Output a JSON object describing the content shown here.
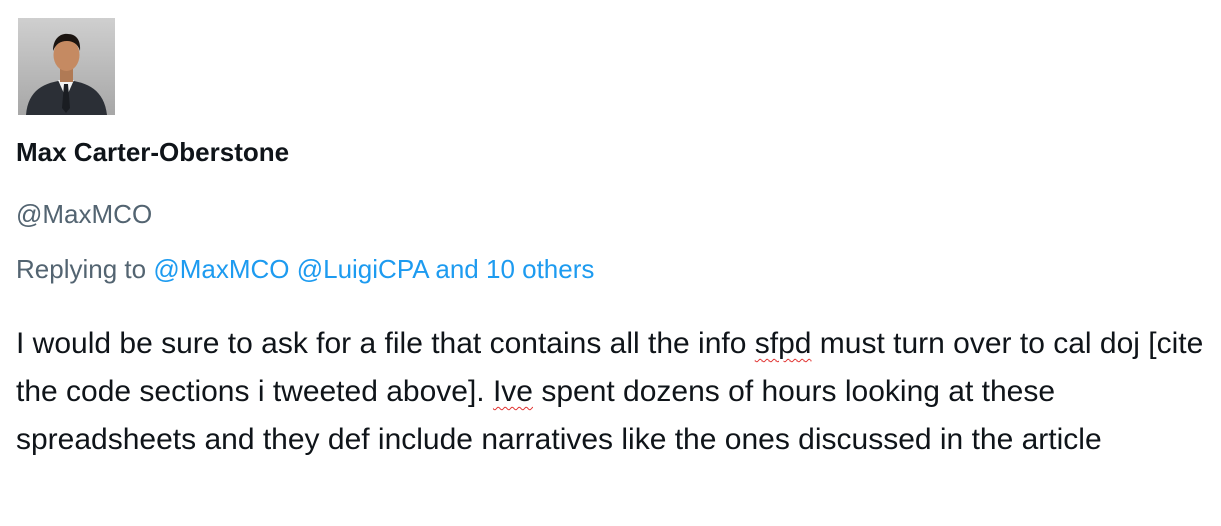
{
  "author": {
    "display_name": "Max Carter-Oberstone",
    "handle": "@MaxMCO"
  },
  "reply": {
    "prefix": "Replying to",
    "mentions": [
      "@MaxMCO",
      "@LuigiCPA"
    ],
    "others": "and 10 others"
  },
  "tweet": {
    "seg1": "I would be sure to ask for a file that contains all the info ",
    "word1": "sfpd",
    "seg2": " must turn over to cal doj [cite the code sections i tweeted above]. ",
    "word2": "Ive",
    "seg3": " spent dozens of hours looking at these spreadsheets and they def include narratives like the ones discussed in the article"
  },
  "colors": {
    "text": "#0f1419",
    "secondary": "#536471",
    "link": "#1d9bf0",
    "spellcheck": "#e0312f"
  }
}
